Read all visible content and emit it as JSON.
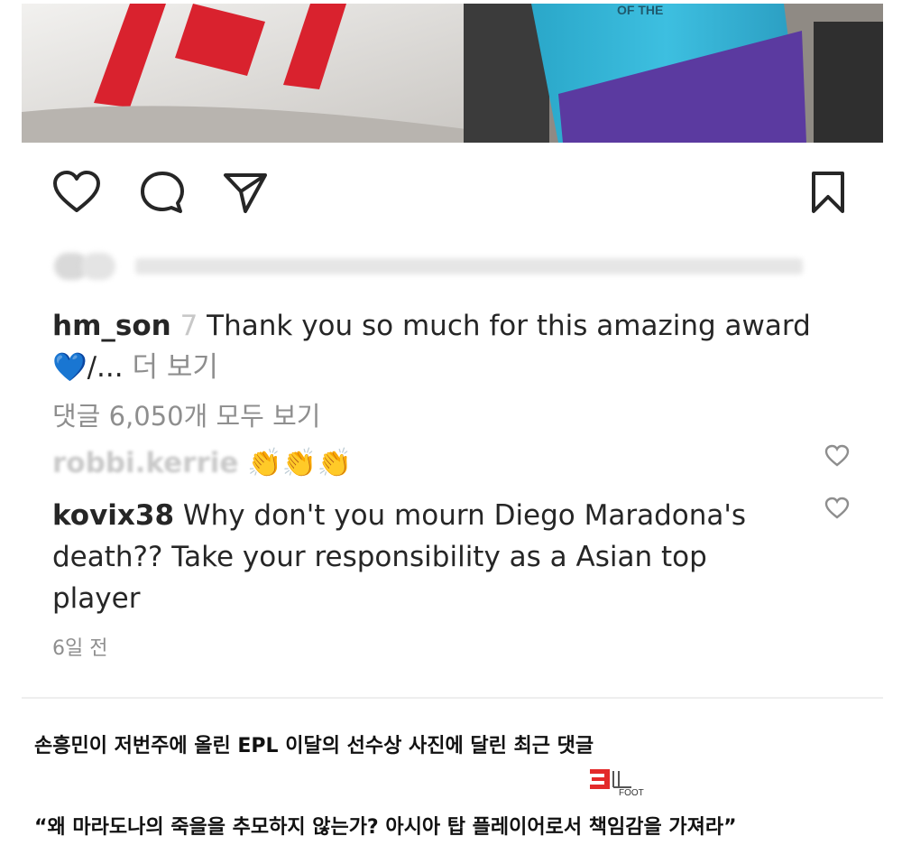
{
  "post": {
    "caption_user": "hm_son",
    "caption_sep": "7",
    "caption_text": "Thank you so much for this amazing award",
    "caption_line2_emoji": "💙",
    "caption_line2_text": "/...",
    "caption_more": "더 보기",
    "view_comments": "댓글 6,050개 모두 보기"
  },
  "comments": [
    {
      "user": "robbi.kerrie",
      "text": "👏👏👏",
      "liked": false
    },
    {
      "user": "kovix38",
      "text": "Why don't you mourn Diego Maradona's death?? Take your responsibility as a Asian top player",
      "liked": false
    }
  ],
  "timestamp": "6일 전",
  "article": {
    "headline": "손흥민이 저번주에 올린 EPL 이달의 선수상 사진에 달린 최근 댓글",
    "quote": "“왜 마라도나의 죽을을 추모하지 않는가? 아시아 탑 플레이어로서 책임감을 가져라”",
    "logo_text": "FOOT"
  },
  "colors": {
    "text": "#262626",
    "muted": "#8e8e8e",
    "logo_red": "#e32a2a"
  },
  "icons": {
    "like": "heart-icon",
    "comment": "comment-bubble-icon",
    "share": "paper-plane-icon",
    "save": "bookmark-icon",
    "comment_like": "small-heart-icon"
  }
}
